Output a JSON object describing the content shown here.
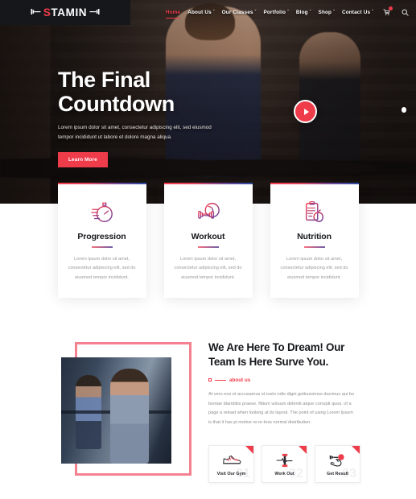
{
  "site": {
    "logo_text": "STAMIN",
    "logo_accent_letter": "S",
    "accent_color": "#ef3c4a",
    "gradient_start": "#f8404f",
    "gradient_end": "#2a4a9e",
    "frame_color": "#f4818f"
  },
  "header": {
    "nav": [
      {
        "label": "Home",
        "has_caret": false,
        "active": true
      },
      {
        "label": "About Us",
        "has_caret": true,
        "active": false
      },
      {
        "label": "Our Classes",
        "has_caret": true,
        "active": false
      },
      {
        "label": "Portfolio",
        "has_caret": true,
        "active": false
      },
      {
        "label": "Blog",
        "has_caret": true,
        "active": false
      },
      {
        "label": "Shop",
        "has_caret": true,
        "active": false
      },
      {
        "label": "Contact Us",
        "has_caret": true,
        "active": false
      }
    ],
    "caret_glyph": "ˇ",
    "cart_icon": "cart-icon",
    "cart_badge": "",
    "search_icon": "search-icon"
  },
  "hero": {
    "title_line1": "The Final",
    "title_line2": "Countdown",
    "subtitle": "Lorem ipsum dolor sit amet, consectetur adipiscing elit, sed eiusmod tempor incididunt ut labore et dolore magna aliqua.",
    "button_label": "Learn More",
    "play_icon": "play-icon",
    "slider_indicator": "slider-dot"
  },
  "features": [
    {
      "icon": "stopwatch-icon",
      "title": "Progression",
      "text": "Lorem ipsum dolor sit amet, consectetur adipiscing elit, sed do eiusmod tempor incididunt."
    },
    {
      "icon": "dumbbell-icon",
      "title": "Workout",
      "text": "Lorem ipsum dolor sit amet, consectetur adipiscing elit, sed do eiusmod tempor incididunt."
    },
    {
      "icon": "clipboard-apple-icon",
      "title": "Nutrition",
      "text": "Lorem ipsum dolor sit amet, consectetur adipiscing elit, sed do eiusmod tempor incididunt."
    }
  ],
  "about": {
    "heading": "We Are Here To Dream! Our Team Is Here Surve You.",
    "eyebrow": "about us",
    "paragraph": "At vero eos et accusamus et iusto odio digni goikussimos ducimus qui bo bontae blanditiis praese. Ntium voluum deleniti atque corrupti quos. of a page a reload when looking at its layout. The point of using Lorem Ipsum is that it has pi motive re-or-less normal distribution.",
    "image_alt": "women-running-on-treadmills"
  },
  "steps": [
    {
      "icon": "sneaker-icon",
      "label": "Visit Our Gym",
      "number": "01"
    },
    {
      "icon": "barbell-icon",
      "label": "Work Out",
      "number": "02"
    },
    {
      "icon": "flex-arm-icon",
      "label": "Get Result",
      "number": "03"
    }
  ]
}
